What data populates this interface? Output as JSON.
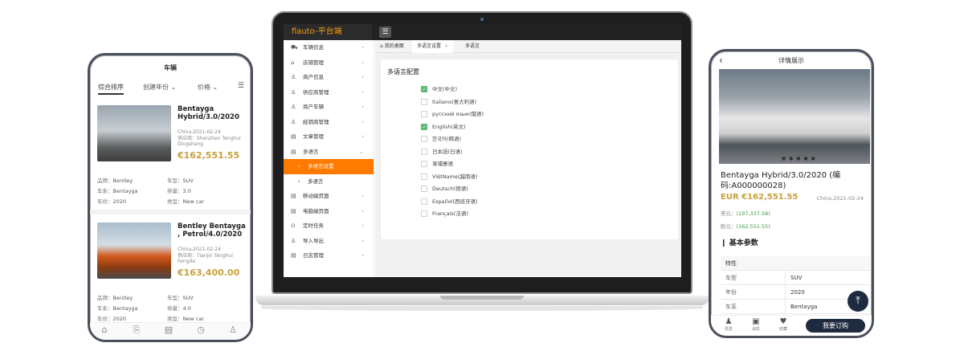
{
  "laptop": {
    "brand": "flauto-平台端",
    "menu_icon": "menu-icon",
    "sidebar": [
      {
        "label": "车辆信息",
        "icon": "car-icon"
      },
      {
        "label": "店铺管理",
        "icon": "store-icon"
      },
      {
        "label": "商户信息",
        "icon": "user-icon"
      },
      {
        "label": "供应商管理",
        "icon": "supplier-icon"
      },
      {
        "label": "商户车辆",
        "icon": "car-icon"
      },
      {
        "label": "经销商管理",
        "icon": "dealer-icon"
      },
      {
        "label": "文章管理",
        "icon": "article-icon"
      },
      {
        "label": "多语言",
        "icon": "language-icon"
      },
      {
        "label": "多语言设置",
        "icon": "chevron-right-icon"
      },
      {
        "label": "多语言",
        "icon": "chevron-right-icon"
      },
      {
        "label": "移动端页面",
        "icon": "mobile-icon"
      },
      {
        "label": "电脑端页面",
        "icon": "desktop-icon"
      },
      {
        "label": "定时任务",
        "icon": "clock-icon"
      },
      {
        "label": "导入导出",
        "icon": "import-icon"
      },
      {
        "label": "日志管理",
        "icon": "log-icon"
      }
    ],
    "tabs": [
      {
        "label": "我的桌面"
      },
      {
        "label": "多语言设置"
      },
      {
        "label": "多语言"
      }
    ],
    "content_title": "多语言配置",
    "languages": [
      {
        "label": "中文(中文)",
        "checked": true
      },
      {
        "label": "Italiano(意大利语)",
        "checked": false
      },
      {
        "label": "русский язык(俄语)",
        "checked": false
      },
      {
        "label": "English(英文)",
        "checked": true
      },
      {
        "label": "한국어(韩语)",
        "checked": false
      },
      {
        "label": "日本語(日语)",
        "checked": false
      },
      {
        "label": "柬埔寨语",
        "checked": false
      },
      {
        "label": "ViệtName(越南语)",
        "checked": false
      },
      {
        "label": "Deutsch(德语)",
        "checked": false
      },
      {
        "label": "Español(西班牙语)",
        "checked": false
      },
      {
        "label": "Français(法语)",
        "checked": false
      }
    ]
  },
  "phone_left": {
    "title": "车辆",
    "filters": {
      "f1": "综合排序",
      "f2": "创建年份",
      "f3": "价格"
    },
    "cars": [
      {
        "name": "Bentayga Hybrid/3.0/2020",
        "date": "China,2021-02-24",
        "supplier": "供应商：Shenzhen Tenghui Dingshang",
        "price": "€162,551.55",
        "specs": {
          "brand_k": "品牌：",
          "brand_v": "Bentley",
          "type_k": "车型：",
          "type_v": "SUV",
          "series_k": "车系：",
          "series_v": "Bentayga",
          "disp_k": "排量：",
          "disp_v": "3.0",
          "year_k": "年份：",
          "year_v": "2020",
          "cat_k": "类型：",
          "cat_v": "New car"
        }
      },
      {
        "name": "Bentley Bentayga , Petrol/4.0/2020",
        "date": "China,2021-02-24",
        "supplier": "供应商：Tianjin Tenghui Fengda",
        "price": "€163,400.00",
        "specs": {
          "brand_k": "品牌：",
          "brand_v": "Bentley",
          "type_k": "车型：",
          "type_v": "SUV",
          "series_k": "车系：",
          "series_v": "Bentayga",
          "disp_k": "排量：",
          "disp_v": "4.0",
          "year_k": "年份：",
          "year_v": "2020",
          "cat_k": "类型：",
          "cat_v": "New car"
        }
      }
    ],
    "bottom_nav": [
      "home-icon",
      "bookmark-icon",
      "list-icon",
      "clock-icon",
      "profile-icon"
    ]
  },
  "phone_right": {
    "title": "详情展示",
    "dots": "● ● ● ● ●",
    "name": "Bentayga Hybrid/3.0/2020 (编码:A000000028)",
    "price": "EUR €162,551.55",
    "date": "China,2021-02-24",
    "usd_label": "美元：",
    "usd_value": "(197,337.58)",
    "eur_label": "欧元：",
    "eur_value": "(162,551.55)",
    "section": "基本参数",
    "table_head": "特性",
    "rows": [
      {
        "k": "车型",
        "v": "SUV"
      },
      {
        "k": "年份",
        "v": "2020"
      },
      {
        "k": "车系",
        "v": "Bentayga"
      }
    ],
    "bottom": {
      "b1": "信息",
      "b2": "消息",
      "b3": "收藏",
      "buy": "我要订购"
    },
    "fab_icon": "back-to-top-icon"
  }
}
